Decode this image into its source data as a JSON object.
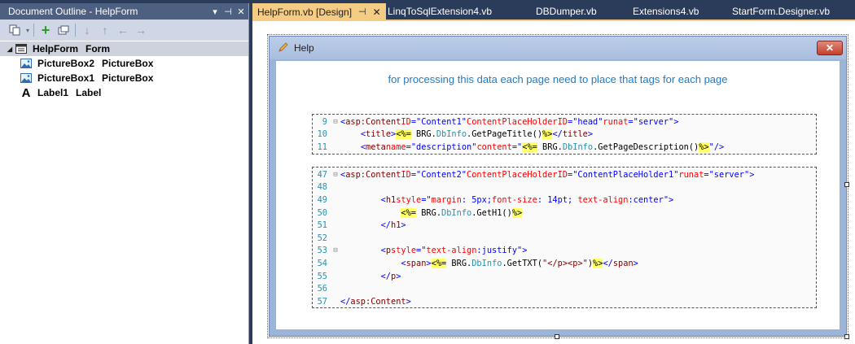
{
  "outline": {
    "title": "Document Outline - HelpForm",
    "controls": [
      "▾",
      "⊣",
      "✕"
    ],
    "tree": [
      {
        "name": "HelpForm",
        "type": "Form"
      },
      {
        "name": "PictureBox2",
        "type": "PictureBox"
      },
      {
        "name": "PictureBox1",
        "type": "PictureBox"
      },
      {
        "name": "Label1",
        "type": "Label"
      }
    ]
  },
  "tabs": [
    {
      "label": "HelpForm.vb [Design]",
      "active": true
    },
    {
      "label": "LinqToSqlExtension4.vb"
    },
    {
      "label": "DBDumper.vb"
    },
    {
      "label": "Extensions4.vb"
    },
    {
      "label": "StartForm.Designer.vb"
    }
  ],
  "form": {
    "title": "Help",
    "close_label": "✕",
    "label1": "for processing this data each page need to place that tags for each page"
  },
  "code1": {
    "lines": [
      {
        "n": "9",
        "text": "<asp:Content ID=\"Content1\" ContentPlaceHolderID=\"head\" runat=\"server\">"
      },
      {
        "n": "10",
        "text": "    <title><%= BRG.DbInfo.GetPageTitle()%></title>"
      },
      {
        "n": "11",
        "text": "    <meta name=\"description\" content=\"<%= BRG.DbInfo.GetPageDescription()%>\" />"
      }
    ]
  },
  "code2": {
    "lines": [
      {
        "n": "47",
        "text": "<asp:Content ID=\"Content2\" ContentPlaceHolderID=\"ContentPlaceHolder1\" runat=\"server\">"
      },
      {
        "n": "48",
        "text": ""
      },
      {
        "n": "49",
        "text": "        <h1 style=\"margin: 5px;font-size: 14pt; text-align:center\">"
      },
      {
        "n": "50",
        "text": "            <%= BRG.DbInfo.GetH1()%>"
      },
      {
        "n": "51",
        "text": "        </h1>"
      },
      {
        "n": "52",
        "text": ""
      },
      {
        "n": "53",
        "text": "        <p style=\"text-align:justify\">"
      },
      {
        "n": "54",
        "text": "            <span><%= BRG.DbInfo.GetTXT(\"</p><p>\")%></span>"
      },
      {
        "n": "55",
        "text": "        </p>"
      },
      {
        "n": "56",
        "text": ""
      },
      {
        "n": "57",
        "text": "</asp:Content>"
      }
    ]
  }
}
